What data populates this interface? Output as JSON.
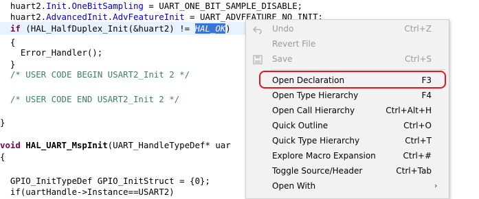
{
  "code": {
    "line1": {
      "obj": "huart2.",
      "field1": "Init",
      "dot": ".",
      "field2": "OneBitSampling",
      "rest": " = UART_ONE_BIT_SAMPLE_DISABLE;"
    },
    "line2": {
      "obj": "huart2.",
      "field1": "AdvancedInit",
      "dot": ".",
      "field2": "AdvFeatureInit",
      "rest": " = UART_ADVFEATURE_NO_INIT;"
    },
    "line3": {
      "kw": "if",
      "pre": " (",
      "fn": "HAL_HalfDuplex_Init",
      "mid": "(&huart2) != ",
      "sel": "HAL_OK",
      "post": ")"
    },
    "line4": "{",
    "line5": "  Error_Handler();",
    "line6": "}",
    "line7": {
      "a": "/* USER CODE BEGIN ",
      "b": "USART2_Init",
      "c": " 2 */"
    },
    "line9": {
      "a": "/* USER CODE END ",
      "b": "USART2_Init",
      "c": " 2 */"
    },
    "line11": "}",
    "line13": {
      "kw": "void",
      "fn": "HAL_UART_MspInit",
      "rest": "(UART_HandleTypeDef* uar"
    },
    "line14": "{",
    "line16": {
      "type": "GPIO_InitTypeDef",
      "rest": " GPIO_InitStruct = {0};"
    },
    "line17": "if(uartHandle->Instance==USART2)"
  },
  "context_menu": {
    "items": [
      {
        "label": "Undo",
        "shortcut": "Ctrl+Z",
        "icon": "undo-icon",
        "enabled": false
      },
      {
        "label": "Revert File",
        "shortcut": "",
        "icon": "",
        "enabled": false
      },
      {
        "label": "Save",
        "shortcut": "Ctrl+S",
        "icon": "save-icon",
        "enabled": false
      },
      {
        "label": "Open Declaration",
        "shortcut": "F3",
        "icon": "",
        "enabled": true
      },
      {
        "label": "Open Type Hierarchy",
        "shortcut": "F4",
        "icon": "",
        "enabled": true
      },
      {
        "label": "Open Call Hierarchy",
        "shortcut": "Ctrl+Alt+H",
        "icon": "",
        "enabled": true
      },
      {
        "label": "Quick Outline",
        "shortcut": "Ctrl+O",
        "icon": "",
        "enabled": true
      },
      {
        "label": "Quick Type Hierarchy",
        "shortcut": "Ctrl+T",
        "icon": "",
        "enabled": true
      },
      {
        "label": "Explore Macro Expansion",
        "shortcut": "Ctrl+#",
        "icon": "",
        "enabled": true
      },
      {
        "label": "Toggle Source/Header",
        "shortcut": "Ctrl+Tab",
        "icon": "",
        "enabled": true
      },
      {
        "label": "Open With",
        "shortcut": "",
        "icon": "",
        "enabled": true,
        "submenu": true
      }
    ],
    "highlight_color": "#e8141c",
    "submenu_arrow": "›"
  },
  "colors": {
    "selection": "#3875d7",
    "keyword": "#7f0055",
    "field": "#0000c0",
    "comment": "#3f7f5f"
  }
}
